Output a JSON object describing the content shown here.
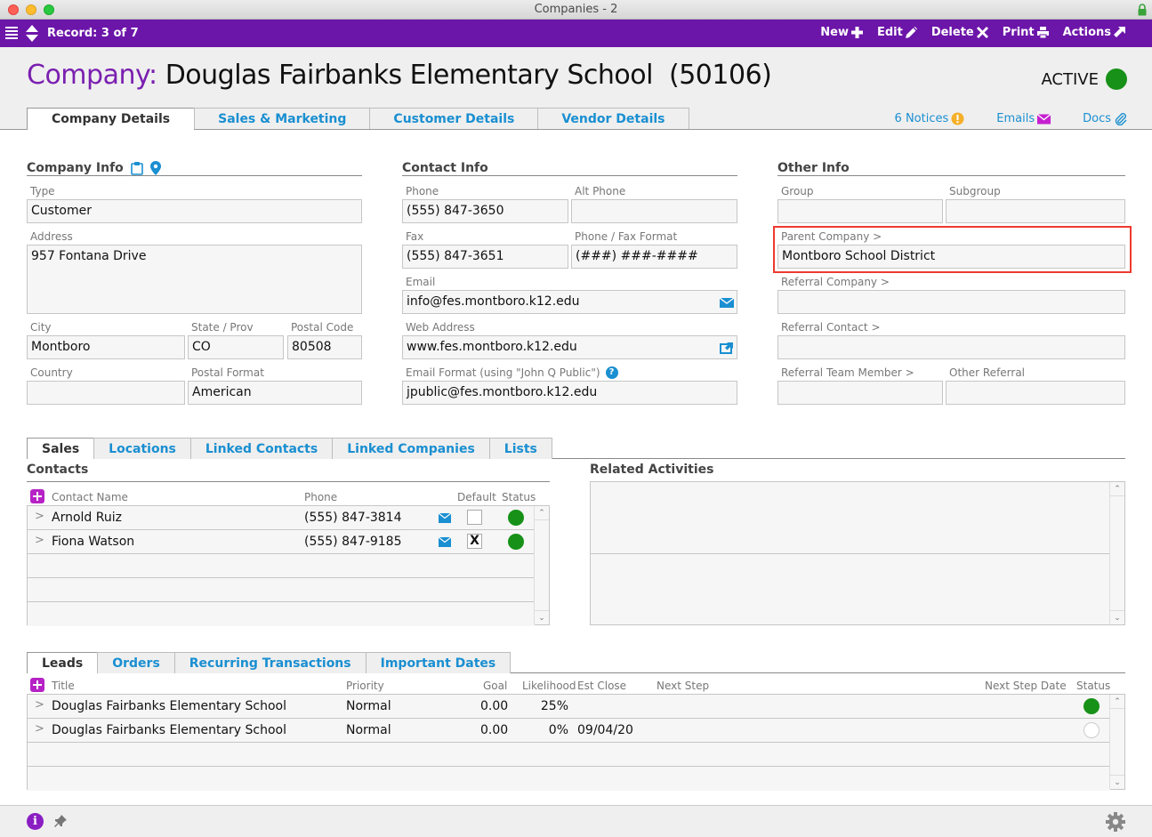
{
  "window": {
    "title": "Companies - 2"
  },
  "toolbar": {
    "record": "Record: 3 of 7",
    "buttons": [
      {
        "label": "New",
        "icon": "plus-icon"
      },
      {
        "label": "Edit",
        "icon": "pencil-icon"
      },
      {
        "label": "Delete",
        "icon": "x-icon"
      },
      {
        "label": "Print",
        "icon": "printer-icon"
      },
      {
        "label": "Actions",
        "icon": "arrow-out-icon"
      }
    ]
  },
  "header": {
    "prefix": "Company:",
    "name": "Douglas Fairbanks Elementary School  (50106)",
    "status": "ACTIVE",
    "status_color": "#179118",
    "tabs": [
      "Company Details",
      "Sales & Marketing",
      "Customer Details",
      "Vendor Details"
    ],
    "active_tab": 0,
    "links": {
      "notices": "6 Notices",
      "emails": "Emails",
      "docs": "Docs"
    }
  },
  "company_info": {
    "title": "Company Info",
    "type": {
      "label": "Type",
      "value": "Customer"
    },
    "address": {
      "label": "Address",
      "value": "957 Fontana Drive"
    },
    "city": {
      "label": "City",
      "value": "Montboro"
    },
    "state": {
      "label": "State / Prov",
      "value": "CO"
    },
    "postal_code": {
      "label": "Postal Code",
      "value": "80508"
    },
    "country": {
      "label": "Country",
      "value": ""
    },
    "postal_format": {
      "label": "Postal Format",
      "value": "American"
    }
  },
  "contact_info": {
    "title": "Contact Info",
    "phone": {
      "label": "Phone",
      "value": "(555) 847-3650"
    },
    "alt_phone": {
      "label": "Alt Phone",
      "value": ""
    },
    "fax": {
      "label": "Fax",
      "value": "(555) 847-3651"
    },
    "phone_format": {
      "label": "Phone / Fax Format",
      "value": "(###) ###-####"
    },
    "email": {
      "label": "Email",
      "value": "info@fes.montboro.k12.edu"
    },
    "web": {
      "label": "Web Address",
      "value": "www.fes.montboro.k12.edu"
    },
    "email_format": {
      "label": "Email Format (using \"John Q Public\")",
      "value": "jpublic@fes.montboro.k12.edu"
    }
  },
  "other_info": {
    "title": "Other Info",
    "group": {
      "label": "Group",
      "value": ""
    },
    "subgroup": {
      "label": "Subgroup",
      "value": ""
    },
    "parent_company": {
      "label": "Parent Company >",
      "value": "Montboro School District"
    },
    "referral_company": {
      "label": "Referral Company >",
      "value": ""
    },
    "referral_contact": {
      "label": "Referral Contact >",
      "value": ""
    },
    "referral_team_member": {
      "label": "Referral Team Member >",
      "value": ""
    },
    "other_referral": {
      "label": "Other Referral",
      "value": ""
    }
  },
  "mid_tabs": [
    "Sales",
    "Locations",
    "Linked Contacts",
    "Linked Companies",
    "Lists"
  ],
  "contacts": {
    "title": "Contacts",
    "columns": [
      "Contact Name",
      "Phone",
      "Default",
      "Status"
    ],
    "rows": [
      {
        "name": "Arnold Ruiz",
        "phone": "(555) 847-3814",
        "default": "",
        "status": "active"
      },
      {
        "name": "Fiona Watson",
        "phone": "(555) 847-9185",
        "default": "X",
        "status": "active"
      }
    ]
  },
  "related_activities": {
    "title": "Related Activities"
  },
  "bottom_tabs": [
    "Leads",
    "Orders",
    "Recurring Transactions",
    "Important Dates"
  ],
  "leads": {
    "columns": [
      "Title",
      "Priority",
      "Goal",
      "Likelihood",
      "Est Close",
      "Next Step",
      "Next Step Date",
      "Status"
    ],
    "rows": [
      {
        "title": "Douglas Fairbanks Elementary School",
        "priority": "Normal",
        "goal": "0.00",
        "likelihood": "25%",
        "est_close": "",
        "next_step": "",
        "next_step_date": "",
        "status": "active"
      },
      {
        "title": "Douglas Fairbanks Elementary School",
        "priority": "Normal",
        "goal": "0.00",
        "likelihood": "0%",
        "est_close": "09/04/20",
        "next_step": "",
        "next_step_date": "",
        "status": "inactive"
      }
    ]
  },
  "colors": {
    "brand": "#6c15a9",
    "link": "#1a8fd1",
    "active": "#179118",
    "highlight": "#ee3a2e",
    "add": "#b622c6"
  }
}
